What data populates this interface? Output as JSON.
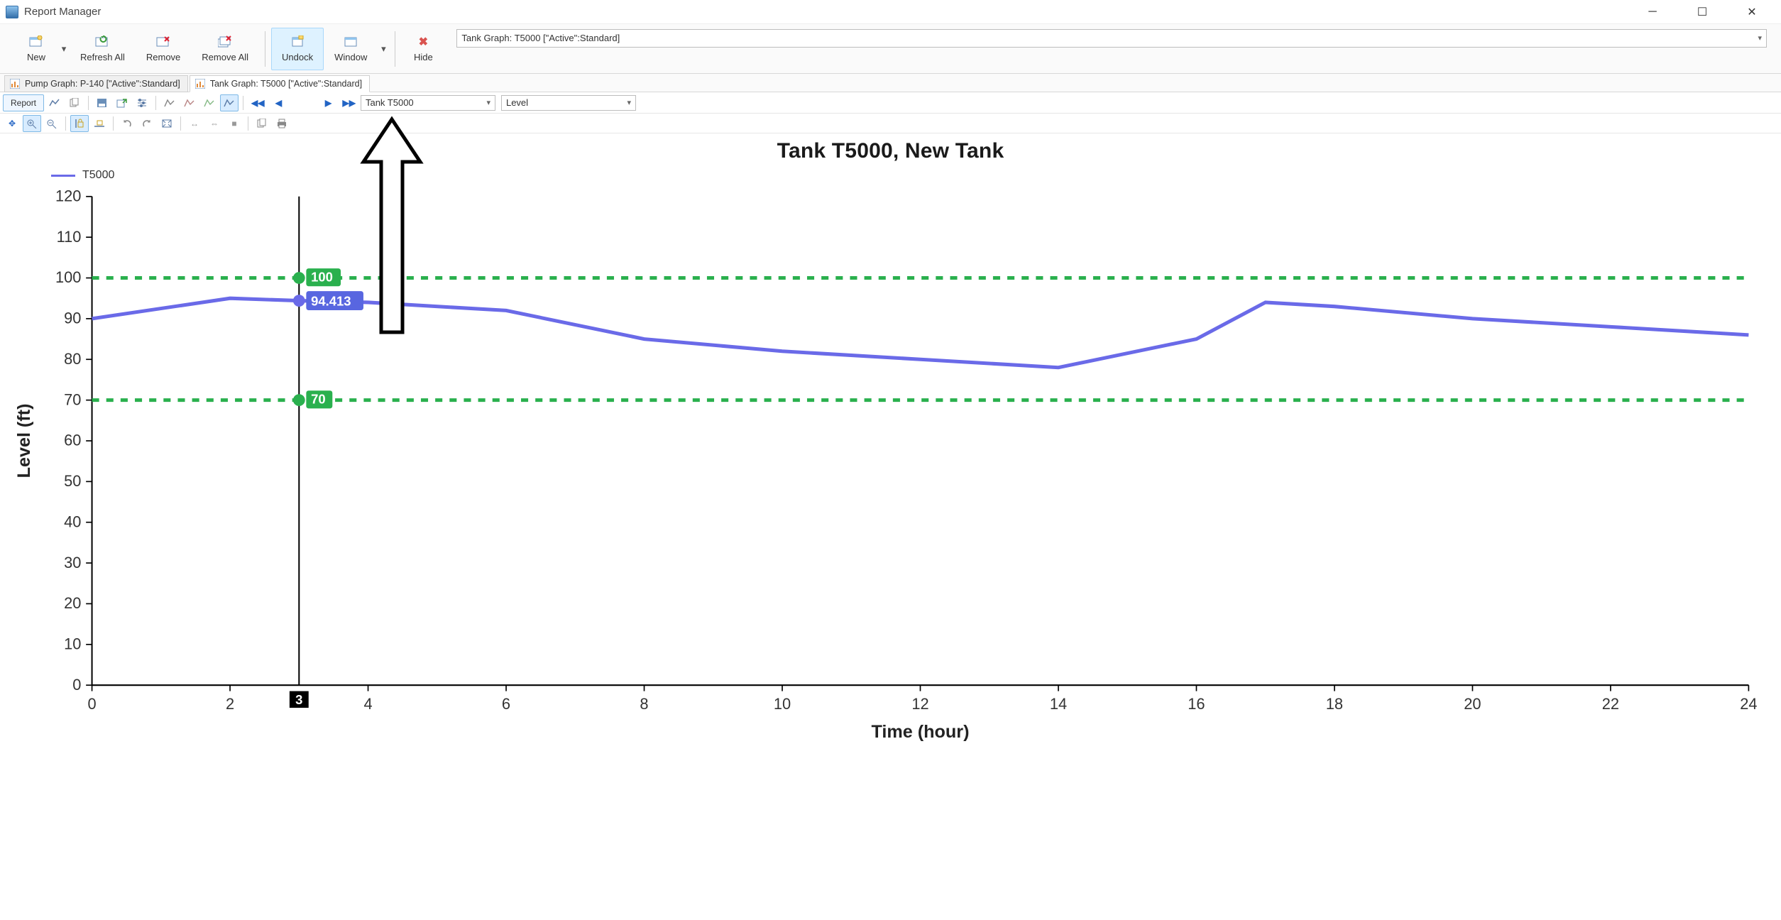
{
  "window": {
    "title": "Report Manager"
  },
  "toolbar": {
    "new": "New",
    "refresh_all": "Refresh All",
    "remove": "Remove",
    "remove_all": "Remove All",
    "undock": "Undock",
    "window": "Window",
    "hide": "Hide",
    "address": "Tank Graph: T5000 [\"Active\":Standard]"
  },
  "tabs": [
    {
      "label": "Pump Graph: P-140 [\"Active\":Standard]"
    },
    {
      "label": "Tank Graph: T5000 [\"Active\":Standard]"
    }
  ],
  "subtoolbar": {
    "report": "Report",
    "element_dd": "Tank T5000",
    "attribute_dd": "Level"
  },
  "chart_data": {
    "type": "line",
    "title": "Tank T5000, New Tank",
    "xlabel": "Time (hour)",
    "ylabel": "Level (ft)",
    "xlim": [
      0,
      24
    ],
    "ylim": [
      0,
      120
    ],
    "xticks": [
      0,
      2,
      4,
      6,
      8,
      10,
      12,
      14,
      16,
      18,
      20,
      22,
      24
    ],
    "yticks": [
      0,
      10,
      20,
      30,
      40,
      50,
      60,
      70,
      80,
      90,
      100,
      110,
      120
    ],
    "series": [
      {
        "name": "T5000",
        "color": "#6a6ae8",
        "x": [
          0,
          2,
          3,
          4,
          6,
          8,
          10,
          12,
          14,
          16,
          17,
          18,
          20,
          22,
          24
        ],
        "values": [
          90,
          95,
          94.413,
          94,
          92,
          85,
          82,
          80,
          78,
          85,
          94,
          93,
          90,
          88,
          86
        ]
      }
    ],
    "reference_lines": [
      {
        "value": 100,
        "label": "100",
        "color": "#2ab04e",
        "style": "dashed"
      },
      {
        "value": 70,
        "label": "70",
        "color": "#2ab04e",
        "style": "dashed"
      }
    ],
    "cursor": {
      "x": 3,
      "x_label": "3",
      "value_label": "94.413"
    },
    "legend": [
      "T5000"
    ]
  }
}
